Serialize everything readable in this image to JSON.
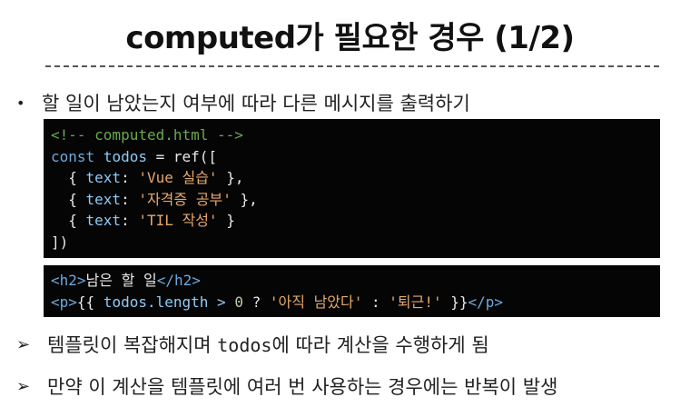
{
  "title": "computed가 필요한 경우 (1/2)",
  "bullet": {
    "symbol": "•",
    "text": "할 일이 남았는지 여부에 따라 다른 메시지를 출력하기"
  },
  "code1": {
    "comment": "<!-- computed.html -->",
    "line2": {
      "kw": "const",
      "var": "todos",
      "rest": " = ref(["
    },
    "items": [
      {
        "open": "  { ",
        "key": "text",
        "colon": ": ",
        "str": "'Vue 실습'",
        "close": " },"
      },
      {
        "open": "  { ",
        "key": "text",
        "colon": ": ",
        "str": "'자격증 공부'",
        "close": " },"
      },
      {
        "open": "  { ",
        "key": "text",
        "colon": ": ",
        "str": "'TIL 작성'",
        "close": " }"
      }
    ],
    "end": "])"
  },
  "code2": {
    "line1": {
      "open_tag": "<h2>",
      "text": "남은 할 일",
      "close_tag": "</h2>"
    },
    "line2": {
      "open_tag": "<p>",
      "mustache_open": "{{ ",
      "expr": "todos.length > ",
      "num": "0",
      "q": " ? ",
      "str1": "'아직 남았다'",
      "colon": " : ",
      "str2": "'퇴근!'",
      "mustache_close": " }}",
      "close_tag": "</p>"
    }
  },
  "arrows": [
    {
      "symbol": "➢",
      "before": "템플릿이 복잡해지며 ",
      "code": "todos",
      "after": "에 따라 계산을 수행하게 됨"
    },
    {
      "symbol": "➢",
      "before": "만약 이 계산을 템플릿에 여러 번 사용하는 경우에는 반복이 발생",
      "code": "",
      "after": ""
    }
  ]
}
